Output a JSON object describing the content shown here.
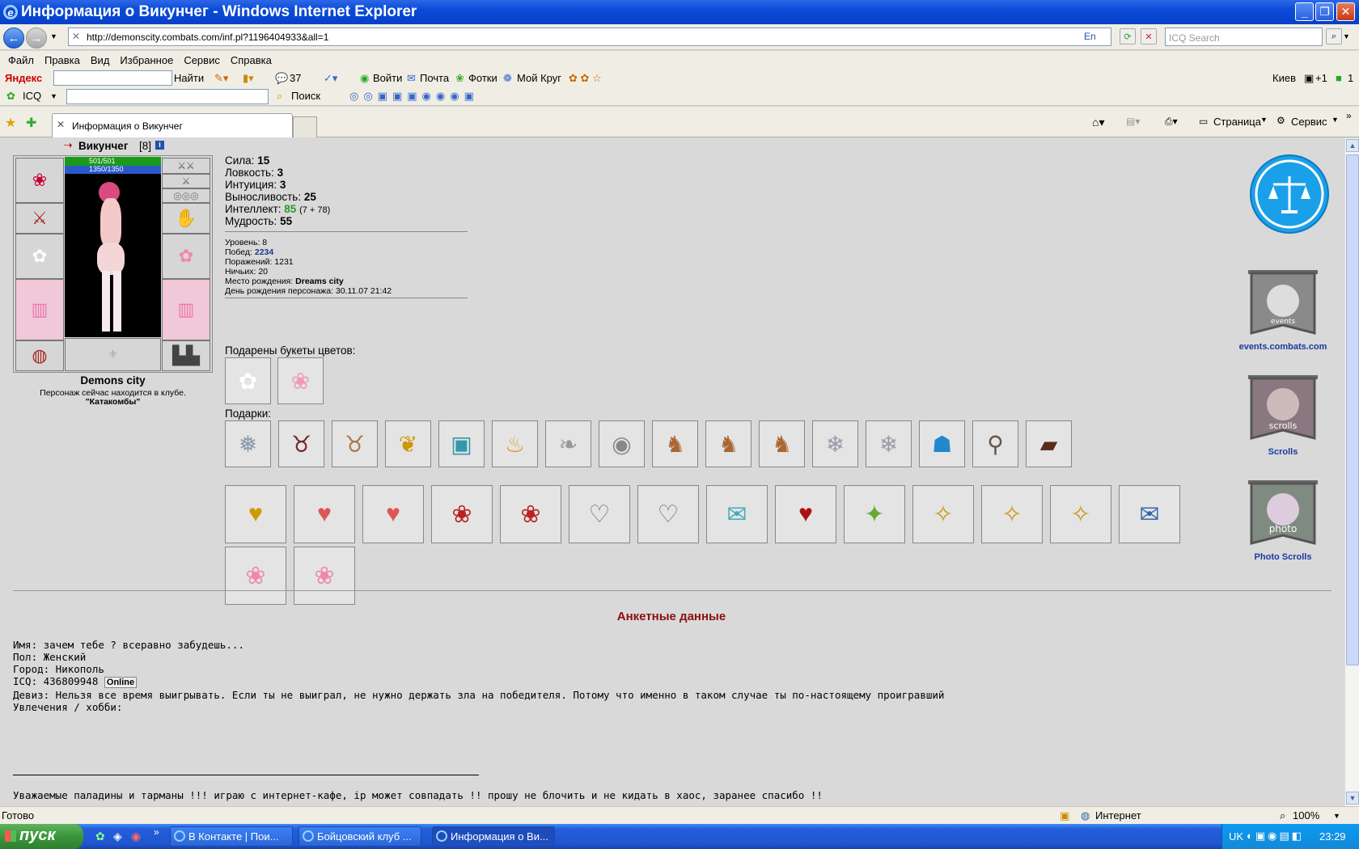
{
  "window": {
    "title": "Информация о Викунчег - Windows Internet Explorer"
  },
  "address": {
    "url": "http://demonscity.combats.com/inf.pl?1196404933&all=1",
    "search_placeholder": "ICQ Search",
    "lang": "En"
  },
  "menu": [
    "Файл",
    "Правка",
    "Вид",
    "Избранное",
    "Сервис",
    "Справка"
  ],
  "toolbar1": {
    "yandex": "Яндекс",
    "find": "Найти",
    "count": "37",
    "login": "Войти",
    "mail": "Почта",
    "photos": "Фотки",
    "circle": "Мой Круг",
    "city": "Киев",
    "temp": "+1",
    "mail_count": "1"
  },
  "toolbar2": {
    "icq": "ICQ",
    "search": "Поиск"
  },
  "tab": {
    "label": "Информация о Викунчег",
    "page": "Страница",
    "service": "Сервис"
  },
  "character": {
    "name": "Викунчег",
    "level_tag": "[8]",
    "hp": "501/501",
    "mana": "1350/1350",
    "city": "Demons city",
    "location_text": "Персонаж сейчас находится в клубе.",
    "location": "\"Катакомбы\""
  },
  "stats": [
    {
      "label": "Сила:",
      "value": "15"
    },
    {
      "label": "Ловкость:",
      "value": "3"
    },
    {
      "label": "Интуиция:",
      "value": "3"
    },
    {
      "label": "Выносливость:",
      "value": "25"
    },
    {
      "label": "Интеллект:",
      "value": "85",
      "extra": "(7 + 78)"
    },
    {
      "label": "Мудрость:",
      "value": "55"
    }
  ],
  "info": {
    "level": "Уровень: 8",
    "wins_label": "Побед:",
    "wins": "2234",
    "losses": "Поражений: 1231",
    "draws": "Ничьих: 20",
    "birthplace_label": "Место рождения:",
    "birthplace": "Dreams city",
    "birthday": "День рождения персонажа: 30.11.07 21:42"
  },
  "gifts": {
    "flowers_label": "Подарены букеты цветов:",
    "gifts_label": "Подарки:"
  },
  "side": {
    "events": "events.combats.com",
    "scrolls": "Scrolls",
    "photo": "Photo Scrolls",
    "banner_events": "events",
    "banner_scrolls": "scrolls",
    "banner_photo": "photo"
  },
  "profile": {
    "heading": "Анкетные данные",
    "name": "Имя: зачем тебе ? всеравно забудешь...",
    "gender": "Пол: Женский",
    "city": "Город: Никополь",
    "icq": "ICQ: 436809948",
    "icq_status": "Online",
    "motto": "Девиз: Нельзя все время выигрывать. Если ты не выиграл, не нужно держать зла на победителя. Потому что именно в таком случае ты по-настоящему проигравший",
    "hobby": "Увлечения / хобби:",
    "note": "Уважаемые паладины и тарманы !!! играю с интернет-кафе, ip может совпадать !! прошу не блочить и не кидать в хаос, заранее спасибо !!"
  },
  "status": {
    "ready": "Готово",
    "zone": "Интернет",
    "zoom": "100%"
  },
  "taskbar": {
    "start": "пуск",
    "tasks": [
      "В Контакте | Пои...",
      "Бойцовский клуб ...",
      "Информация о Ви..."
    ],
    "lang": "UK",
    "time": "23:29"
  }
}
